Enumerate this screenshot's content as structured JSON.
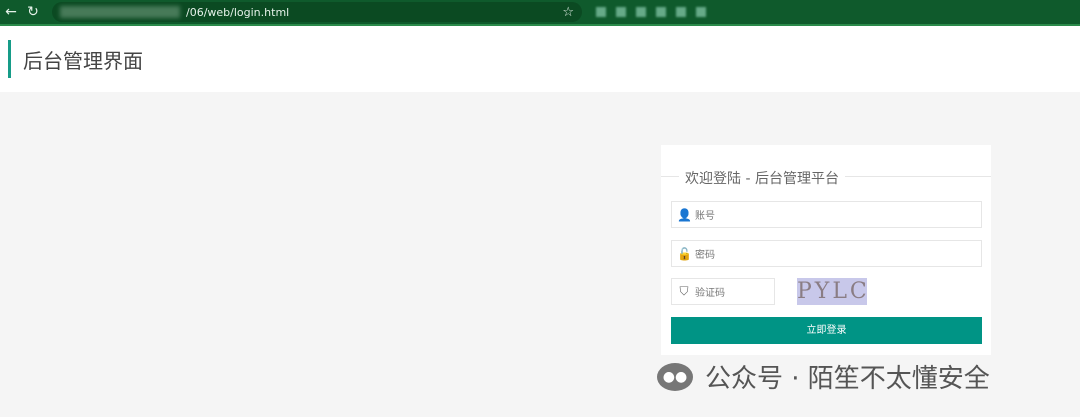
{
  "browser": {
    "url": "/06/web/login.html"
  },
  "header": {
    "title": "后台管理界面"
  },
  "login": {
    "welcome": "欢迎登陆 - 后台管理平台",
    "username_placeholder": "账号",
    "password_placeholder": "密码",
    "captcha_placeholder": "验证码",
    "captcha_text": "PYLC",
    "submit_label": "立即登录"
  },
  "watermark": {
    "text": "公众号 · 陌笙不太懂安全"
  }
}
